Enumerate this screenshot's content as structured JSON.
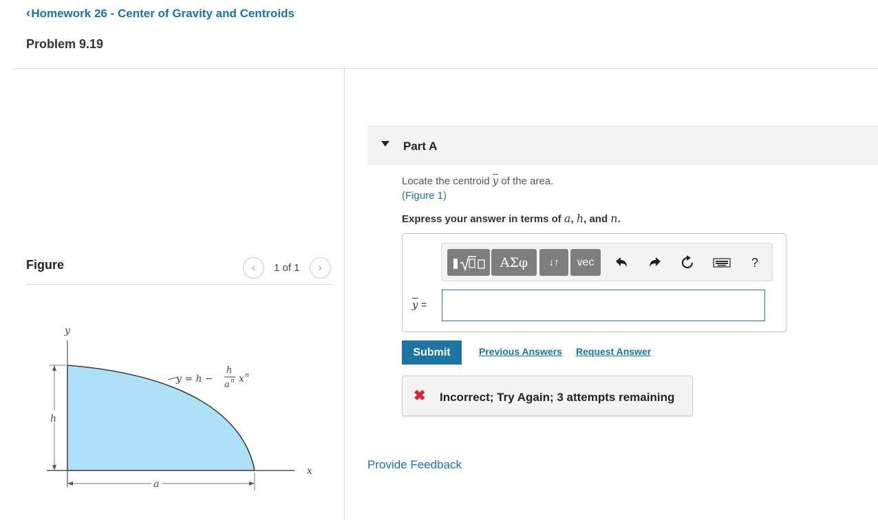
{
  "header": {
    "back_label": "Homework 26 - Center of Gravity and Centroids",
    "problem_title": "Problem 9.19"
  },
  "figure_panel": {
    "label": "Figure",
    "pager_text": "1 of 1",
    "prev_icon": "chevron-left-icon",
    "next_icon": "chevron-right-icon",
    "diagram": {
      "y_axis_label": "y",
      "x_axis_label": "x",
      "height_label": "h",
      "width_label": "a",
      "equation_lhs": "y = h −",
      "eq_numerator": "h",
      "eq_denominator": "a",
      "eq_denominator_exp": "n",
      "eq_var": "x",
      "eq_exp": "n",
      "fill_color": "#aee0f7"
    }
  },
  "part": {
    "title": "Part A",
    "question_prefix": "Locate the centroid ",
    "question_symbol": "y",
    "question_suffix": " of the area.",
    "figure_link_open": "(",
    "figure_link": "Figure 1",
    "figure_link_close": ")",
    "express_prefix": "Express your answer in terms of ",
    "var_a": "a",
    "var_h": "h",
    "var_n": "n",
    "sep1": ", ",
    "sep2": ", and ",
    "express_suffix": ".",
    "toolbar": {
      "greek_label": "ΑΣφ",
      "arrows_label": "↓↑",
      "vec_label": "vec",
      "help_label": "?",
      "icons": [
        "sqrt-template-icon",
        "undo-icon",
        "redo-icon",
        "reset-icon",
        "keyboard-icon"
      ]
    },
    "input_label_symbol": "y",
    "input_label_eq": " =",
    "input_value": "",
    "submit_label": "Submit",
    "previous_answers_label": "Previous Answers",
    "request_answer_label": "Request Answer",
    "feedback_text": "Incorrect; Try Again; 3 attempts remaining",
    "feedback_icon": "x-mark-icon",
    "feedback_icon_color": "#d3252b"
  },
  "footer": {
    "provide_feedback": "Provide Feedback"
  },
  "colors": {
    "link": "#1a73a8",
    "submit_bg": "#1d75a3",
    "toolbar_button": "#7e7e7e"
  }
}
